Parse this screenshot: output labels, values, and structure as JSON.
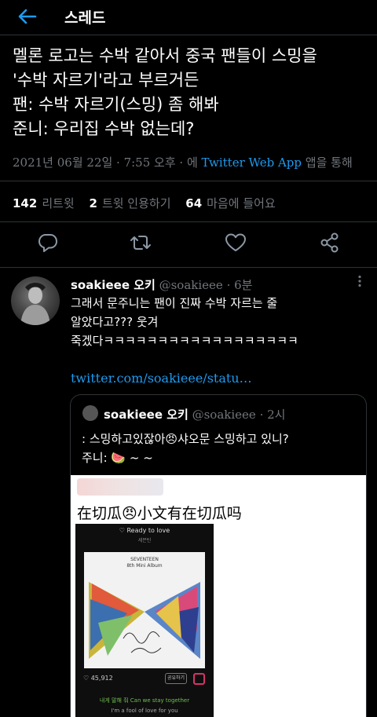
{
  "header": {
    "title": "스레드",
    "back_icon": "arrow-left-icon"
  },
  "tweet": {
    "lines": [
      "멜론 로고는 수박 같아서 중국 팬들이 스밍을",
      "'수박 자르기'라고 부르거든",
      "팬: 수박 자르기(스밍) 좀 해봐",
      "준니: 우리집 수박 없는데?"
    ],
    "meta_time": "2021년 06월 22일 · 7:55 오후 · 에",
    "meta_app": "Twitter Web App",
    "meta_suffix": "앱을 통해",
    "stats": {
      "retweets_count": "142",
      "retweets_label": "리트윗",
      "quotes_count": "2",
      "quotes_label": "트윗 인용하기",
      "likes_count": "64",
      "likes_label": "마음에 들어요"
    },
    "actions": [
      "reply-icon",
      "retweet-icon",
      "like-icon",
      "share-icon"
    ]
  },
  "reply": {
    "name": "soakieee 오키",
    "handle": "@soakieee · 6분",
    "lines": [
      "그래서 문주니는 팬이 진짜 수박 자르는 줄",
      "알았다고??? 웃겨",
      "죽겠다ㅋㅋㅋㅋㅋㅋㅋㅋㅋㅋㅋㅋㅋㅋㅋㅋㅋㅋ"
    ],
    "link": "twitter.com/soakieee/statu…"
  },
  "quote": {
    "name": "soakieee 오키",
    "handle": "@soakieee · 2시",
    "line1": ": 스밍하고있잖아😠샤오문 스밍하고 있니?",
    "line2": "주니: 🍉 ~ ~",
    "image_caption": "在切瓜😠小文有在切瓜吗",
    "phone": {
      "song_title": "♡ Ready to love",
      "artist": "세븐틴",
      "album_line1": "SEVENTEEN",
      "album_line2": "8th Mini Album",
      "album_script": "Your Choice",
      "likes": "♡ 45,912",
      "button_label": "공유하기",
      "lyric1": "내게 말해 줘 Can we stay together",
      "lyric2": "I'm a fool of love for you"
    }
  }
}
